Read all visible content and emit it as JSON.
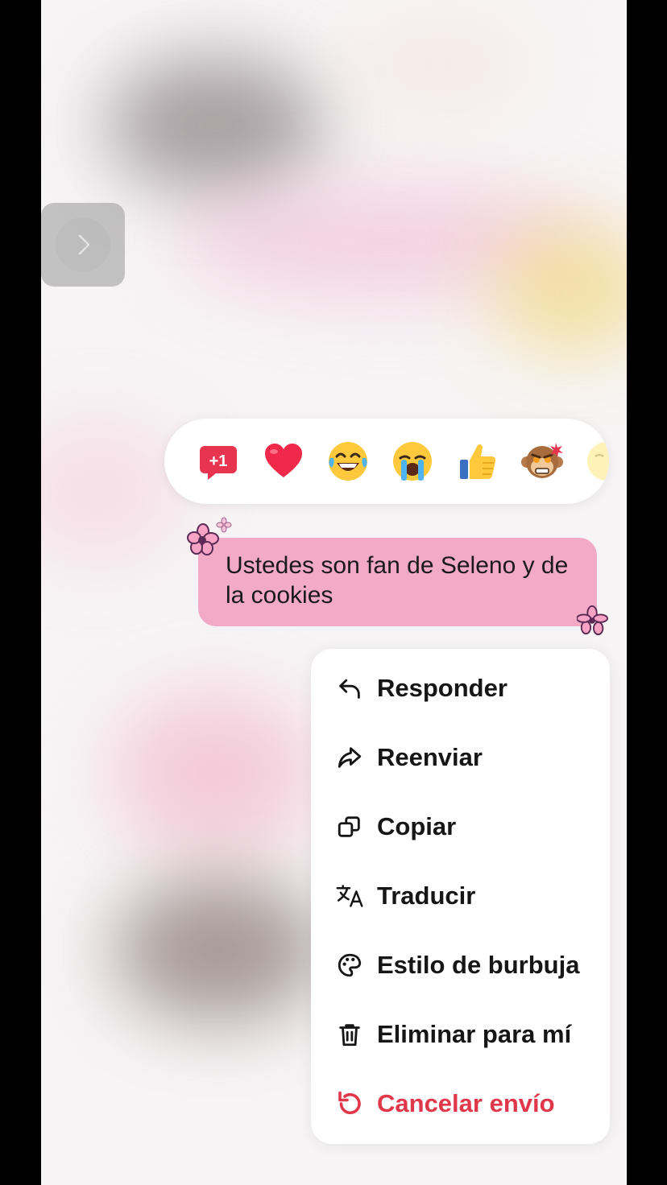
{
  "navigation": {
    "forward_button": "chevron-right-icon"
  },
  "reactions": [
    {
      "name": "plus-one-reaction",
      "glyph": "+1"
    },
    {
      "name": "heart-reaction",
      "glyph": "❤️"
    },
    {
      "name": "laughing-reaction",
      "glyph": "😂"
    },
    {
      "name": "crying-reaction",
      "glyph": "😭"
    },
    {
      "name": "thumbs-up-reaction",
      "glyph": "👍"
    },
    {
      "name": "angry-monkey-reaction",
      "glyph": "🙈"
    },
    {
      "name": "more-reaction",
      "glyph": "😊"
    }
  ],
  "message": {
    "text": "Ustedes son fan de Seleno y de la cookies",
    "bubble_color": "#f2aac7"
  },
  "menu": {
    "items": [
      {
        "label": "Responder",
        "icon": "reply-icon"
      },
      {
        "label": "Reenviar",
        "icon": "forward-icon"
      },
      {
        "label": "Copiar",
        "icon": "copy-icon"
      },
      {
        "label": "Traducir",
        "icon": "translate-icon"
      },
      {
        "label": "Estilo de burbuja",
        "icon": "palette-icon"
      },
      {
        "label": "Eliminar para mí",
        "icon": "trash-icon"
      },
      {
        "label": "Cancelar envío",
        "icon": "undo-icon",
        "color": "#e0384a"
      }
    ]
  }
}
